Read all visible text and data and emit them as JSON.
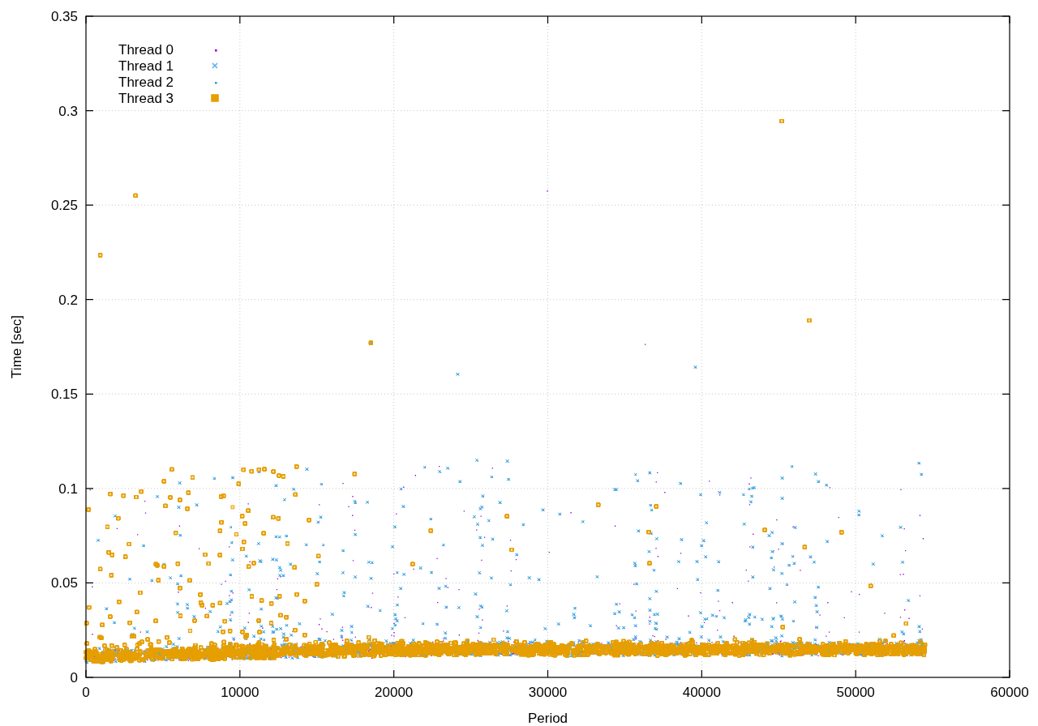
{
  "plot": {
    "grid": true,
    "x_axis": {
      "label": "Period",
      "ticks": [
        "0",
        "10000",
        "20000",
        "30000",
        "40000",
        "50000",
        "60000"
      ]
    },
    "y_axis": {
      "label": "Time [sec]",
      "ticks": [
        "0.35",
        "0.3",
        "0.25",
        "0.2",
        "0.15",
        "0.1",
        "0.05",
        "0"
      ]
    },
    "legend": [
      {
        "name": "Thread 0",
        "color": "#9400d3",
        "kind": "dot"
      },
      {
        "name": "Thread 1",
        "color": "#56b4e9",
        "kind": "cross"
      },
      {
        "name": "Thread 2",
        "color": "#3fa0c0",
        "kind": "dot"
      },
      {
        "name": "Thread 3",
        "color": "#e69f00",
        "kind": "square"
      }
    ]
  }
}
